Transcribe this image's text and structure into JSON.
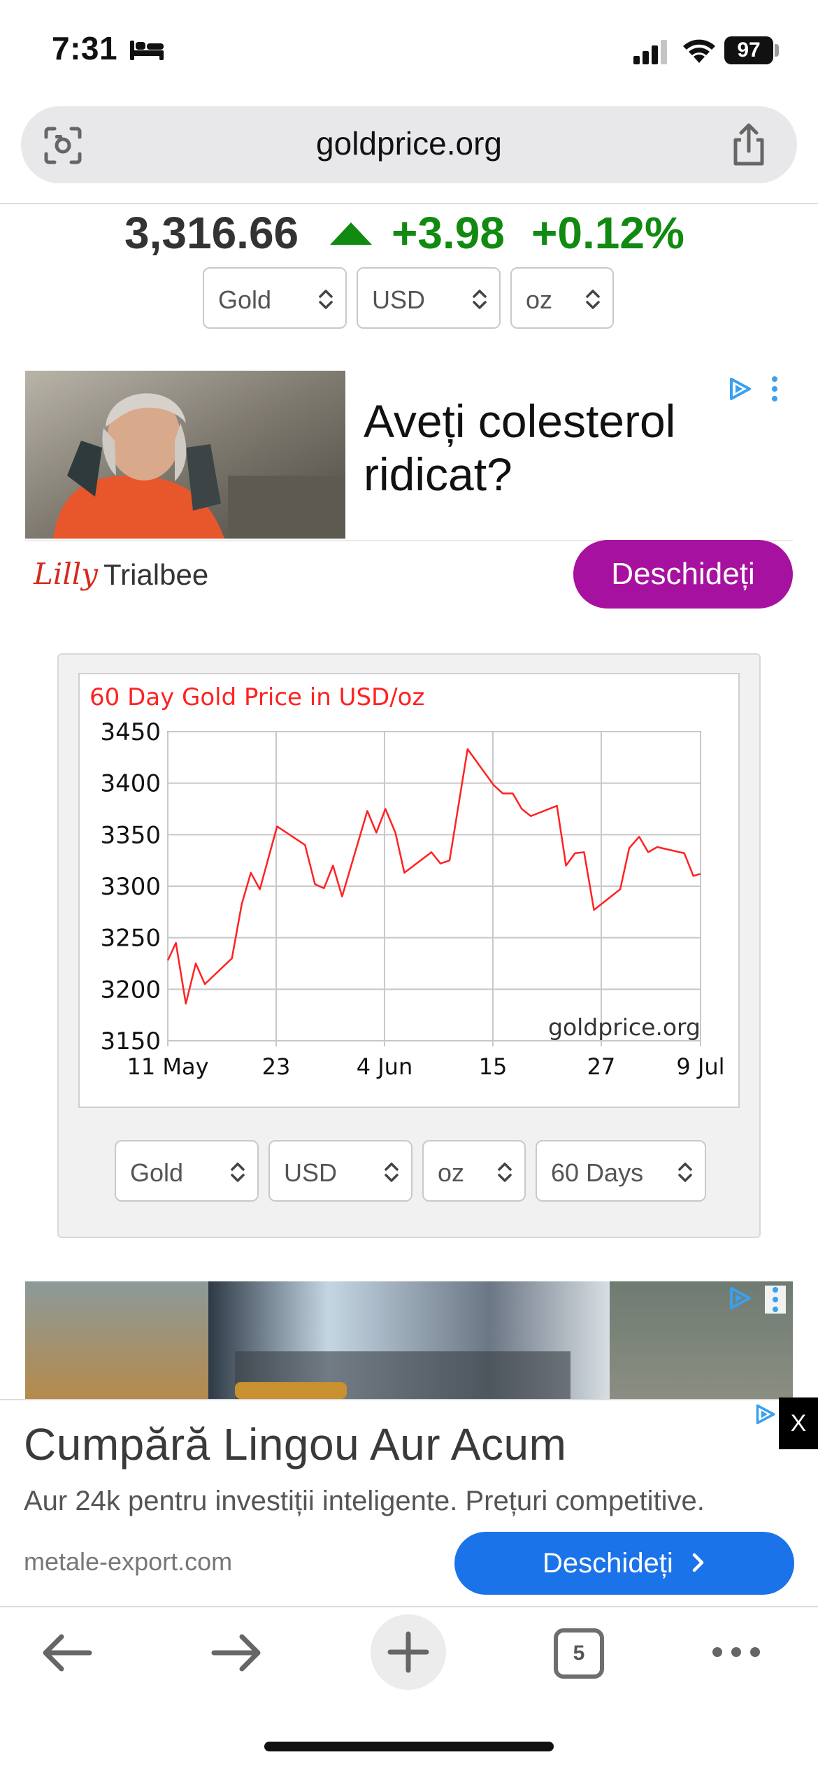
{
  "status_bar": {
    "time": "7:31",
    "battery": "97",
    "icons": [
      "bed-icon",
      "signal-icon",
      "wifi-icon",
      "battery-icon"
    ]
  },
  "browser": {
    "url": "goldprice.org",
    "icons": [
      "scan-icon",
      "share-icon"
    ]
  },
  "price": {
    "value": "3,316.66",
    "change": "+3.98",
    "percent": "+0.12%",
    "direction_icon": "up-arrow-icon",
    "up_color": "#108a10",
    "selects": [
      {
        "value": "Gold"
      },
      {
        "value": "USD"
      },
      {
        "value": "oz"
      }
    ]
  },
  "ad1": {
    "title": "Aveți colesterol ridicat?",
    "logo": "Lilly",
    "brand": "Trialbee",
    "cta": "Deschideți",
    "cta_color": "#a7119f"
  },
  "chart_data": {
    "type": "line",
    "title": "60 Day Gold Price in USD/oz",
    "watermark": "goldprice.org",
    "ylim": [
      3150,
      3450
    ],
    "yticks": [
      "3450",
      "3400",
      "3350",
      "3300",
      "3250",
      "3200",
      "3150"
    ],
    "xticks": [
      "11 May",
      "23",
      "4 Jun",
      "15",
      "27",
      "9 Jul"
    ],
    "xtick_days": [
      0,
      12,
      24,
      36,
      48,
      59
    ],
    "xlim": [
      0,
      59
    ],
    "grid": true,
    "line_color": "#ff2222",
    "series": [
      {
        "points": [
          [
            0,
            3228
          ],
          [
            0.9,
            3245
          ],
          [
            2,
            3186
          ],
          [
            3.1,
            3225
          ],
          [
            4.1,
            3205
          ],
          [
            7.1,
            3230
          ],
          [
            8.2,
            3283
          ],
          [
            9.2,
            3313
          ],
          [
            10.2,
            3297
          ],
          [
            12.1,
            3358
          ],
          [
            15.2,
            3340
          ],
          [
            16.3,
            3302
          ],
          [
            17.3,
            3298
          ],
          [
            18.3,
            3320
          ],
          [
            19.3,
            3290
          ],
          [
            22.1,
            3373
          ],
          [
            23.1,
            3352
          ],
          [
            24.1,
            3375
          ],
          [
            25.2,
            3352
          ],
          [
            26.2,
            3313
          ],
          [
            29.2,
            3333
          ],
          [
            30.2,
            3322
          ],
          [
            31.2,
            3325
          ],
          [
            33.2,
            3433
          ],
          [
            36.1,
            3398
          ],
          [
            37.1,
            3390
          ],
          [
            38.2,
            3390
          ],
          [
            39.2,
            3375
          ],
          [
            40.2,
            3368
          ],
          [
            43.1,
            3378
          ],
          [
            44.1,
            3320
          ],
          [
            45.1,
            3332
          ],
          [
            46.1,
            3333
          ],
          [
            47.2,
            3277
          ],
          [
            50.1,
            3297
          ],
          [
            51.1,
            3337
          ],
          [
            52.2,
            3348
          ],
          [
            53.2,
            3333
          ],
          [
            54.2,
            3338
          ],
          [
            57.2,
            3332
          ],
          [
            58.2,
            3310
          ],
          [
            59,
            3312
          ]
        ]
      }
    ],
    "selects": [
      {
        "value": "Gold"
      },
      {
        "value": "USD"
      },
      {
        "value": "oz"
      },
      {
        "value": "60 Days"
      }
    ]
  },
  "banner_ad": {
    "title": "Cumpără Lingou Aur Acum",
    "subtitle": "Aur 24k pentru investiții inteligente. Prețuri competitive.",
    "domain": "metale-export.com",
    "cta": "Deschideți",
    "close": "X",
    "cta_color": "#1a73e8"
  },
  "toolbar": {
    "tab_count": "5",
    "icons": [
      "back-arrow-icon",
      "forward-arrow-icon",
      "new-tab-icon",
      "tabs-icon",
      "more-icon"
    ]
  }
}
